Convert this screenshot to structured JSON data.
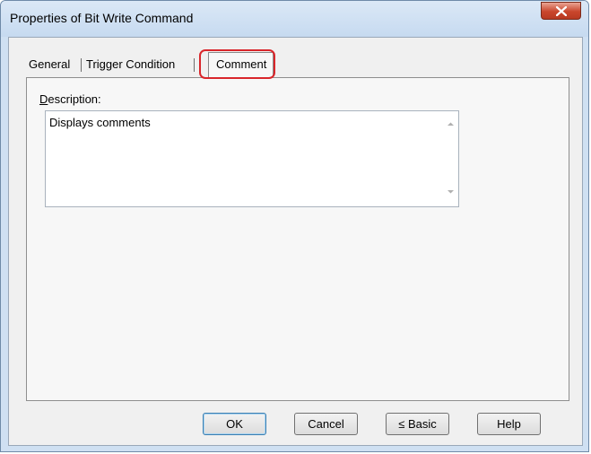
{
  "window": {
    "title": "Properties of Bit Write Command"
  },
  "tabs": [
    {
      "label": "General",
      "active": false
    },
    {
      "label": "Trigger Condition",
      "active": false
    },
    {
      "label": "Comment",
      "active": true
    }
  ],
  "comment_tab": {
    "description_label": "Description:",
    "description_value": "Displays comments"
  },
  "buttons": {
    "ok": "OK",
    "cancel": "Cancel",
    "basic": "≤ Basic",
    "help": "Help"
  },
  "colors": {
    "highlight": "#d9262b",
    "close_button": "#c9462c",
    "window_frame": "#cfe0f2"
  }
}
